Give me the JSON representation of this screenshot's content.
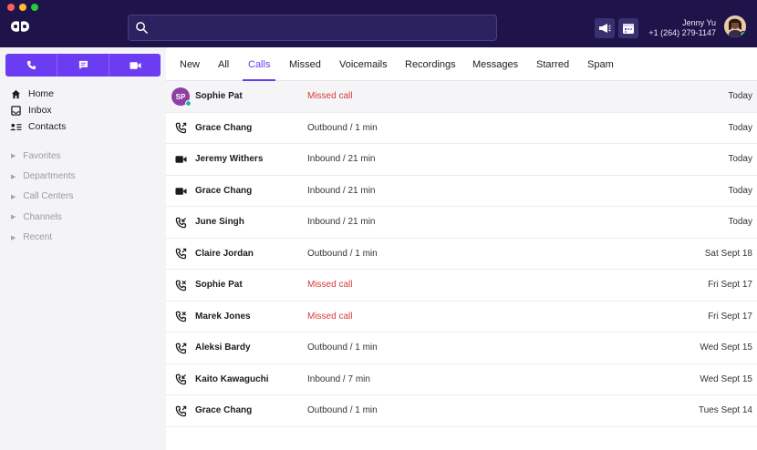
{
  "header": {
    "user_name": "Jenny Yu",
    "user_phone": "+1 (264) 279-1147",
    "search_placeholder": ""
  },
  "sidebar": {
    "main_items": [
      {
        "label": "Home",
        "icon": "home-icon"
      },
      {
        "label": "Inbox",
        "icon": "inbox-icon"
      },
      {
        "label": "Contacts",
        "icon": "contacts-icon"
      }
    ],
    "sections": [
      {
        "label": "Favorites"
      },
      {
        "label": "Departments"
      },
      {
        "label": "Call Centers"
      },
      {
        "label": "Channels"
      },
      {
        "label": "Recent"
      }
    ]
  },
  "tabs": [
    {
      "label": "New"
    },
    {
      "label": "All"
    },
    {
      "label": "Calls"
    },
    {
      "label": "Missed"
    },
    {
      "label": "Voicemails"
    },
    {
      "label": "Recordings"
    },
    {
      "label": "Messages"
    },
    {
      "label": "Starred"
    },
    {
      "label": "Spam"
    }
  ],
  "active_tab": "Calls",
  "rows": [
    {
      "name": "Sophie Pat",
      "detail": "Missed call",
      "date": "Today",
      "type": "avatar",
      "initials": "SP",
      "missed": true
    },
    {
      "name": "Grace Chang",
      "detail": "Outbound / 1 min",
      "date": "Today",
      "type": "phone-icon",
      "missed": false
    },
    {
      "name": "Jeremy Withers",
      "detail": "Inbound / 21 min",
      "date": "Today",
      "type": "video-icon",
      "missed": false
    },
    {
      "name": "Grace Chang",
      "detail": "Inbound / 21 min",
      "date": "Today",
      "type": "video-icon",
      "missed": false
    },
    {
      "name": "June Singh",
      "detail": "Inbound / 21 min",
      "date": "Today",
      "type": "phone-icon",
      "missed": false
    },
    {
      "name": "Claire Jordan",
      "detail": "Outbound / 1 min",
      "date": "Sat Sept 18",
      "type": "phone-icon",
      "missed": false
    },
    {
      "name": "Sophie Pat",
      "detail": "Missed call",
      "date": "Fri Sept 17",
      "type": "phone-icon",
      "missed": true
    },
    {
      "name": "Marek Jones",
      "detail": "Missed call",
      "date": "Fri Sept 17",
      "type": "phone-icon",
      "missed": true
    },
    {
      "name": "Aleksi Bardy",
      "detail": "Outbound / 1 min",
      "date": "Wed Sept 15",
      "type": "phone-icon",
      "missed": false
    },
    {
      "name": "Kaito Kawaguchi",
      "detail": "Inbound / 7 min",
      "date": "Wed Sept 15",
      "type": "phone-icon",
      "missed": false
    },
    {
      "name": "Grace Chang",
      "detail": "Outbound / 1 min",
      "date": "Tues Sept 14",
      "type": "phone-icon",
      "missed": false
    }
  ],
  "colors": {
    "header_bg": "#1f1449",
    "accent": "#6c3cf2",
    "missed": "#d93a3a"
  }
}
